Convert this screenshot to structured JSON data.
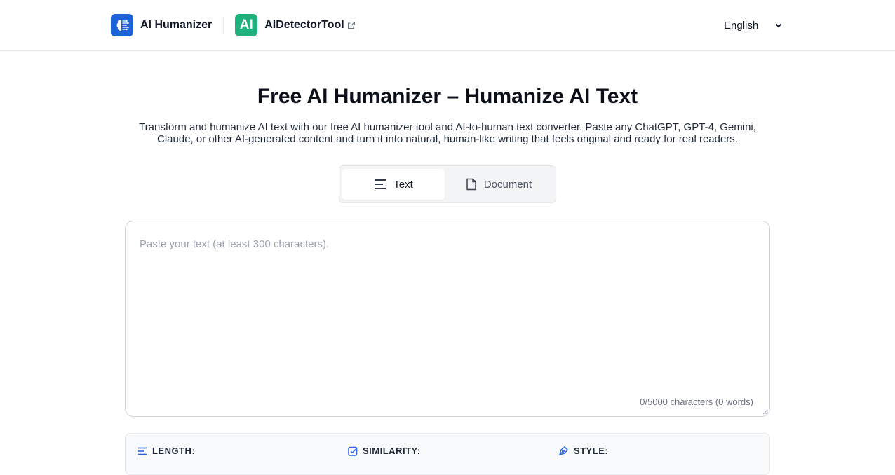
{
  "header": {
    "brand_name": "AI Humanizer",
    "brand_logo_icon": "brain-circuit-icon",
    "detector_logo_text": "AI",
    "detector_name": "AIDetectorTool",
    "external_link_icon": "external-link-icon",
    "language": "English"
  },
  "hero": {
    "title": "Free AI Humanizer – Humanize AI Text",
    "subtitle": "Transform and humanize AI text with our free AI humanizer tool and AI-to-human text converter. Paste any ChatGPT, GPT-4, Gemini, Claude, or other AI-generated content and turn it into natural, human-like writing that feels original and ready for real readers."
  },
  "tabs": [
    {
      "label": "Text",
      "icon": "lines-icon",
      "active": true
    },
    {
      "label": "Document",
      "icon": "file-icon",
      "active": false
    }
  ],
  "editor": {
    "placeholder": "Paste your text (at least 300 characters).",
    "value": "",
    "counter": "0/5000 characters (0 words)"
  },
  "options": {
    "length_label": "LENGTH:",
    "similarity_label": "SIMILARITY:",
    "style_label": "STYLE:"
  },
  "colors": {
    "brand_blue": "#1d63d8",
    "detector_green": "#1fb27c",
    "accent_icon_blue": "#2563eb"
  }
}
